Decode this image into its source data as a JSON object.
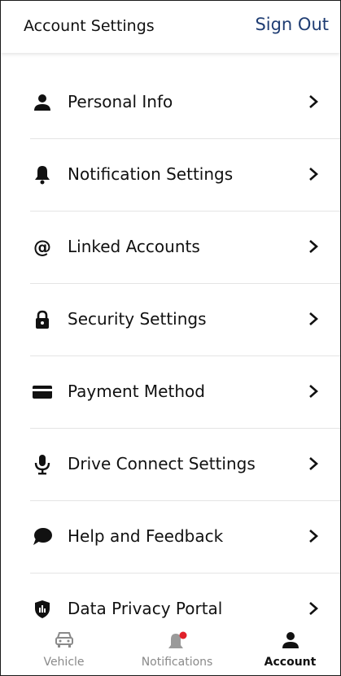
{
  "header": {
    "title": "Account Settings",
    "sign_out_label": "Sign Out"
  },
  "menu": {
    "items": [
      {
        "label": "Personal Info",
        "icon": "person-icon"
      },
      {
        "label": "Notification Settings",
        "icon": "bell-icon"
      },
      {
        "label": "Linked Accounts",
        "icon": "at-sign-icon"
      },
      {
        "label": "Security Settings",
        "icon": "lock-icon"
      },
      {
        "label": "Payment Method",
        "icon": "credit-card-icon"
      },
      {
        "label": "Drive Connect Settings",
        "icon": "microphone-icon"
      },
      {
        "label": "Help and Feedback",
        "icon": "chat-bubble-icon"
      },
      {
        "label": "Data Privacy Portal",
        "icon": "shield-icon"
      }
    ]
  },
  "tabbar": {
    "tabs": [
      {
        "label": "Vehicle",
        "icon": "car-icon",
        "active": false
      },
      {
        "label": "Notifications",
        "icon": "bell-icon",
        "active": false,
        "has_badge": true
      },
      {
        "label": "Account",
        "icon": "person-icon",
        "active": true
      }
    ],
    "badge_color": "#e0202a"
  },
  "colors": {
    "sign_out": "#1f3d73",
    "inactive_tab": "#8a8a8a",
    "divider": "#e4e4e4"
  }
}
